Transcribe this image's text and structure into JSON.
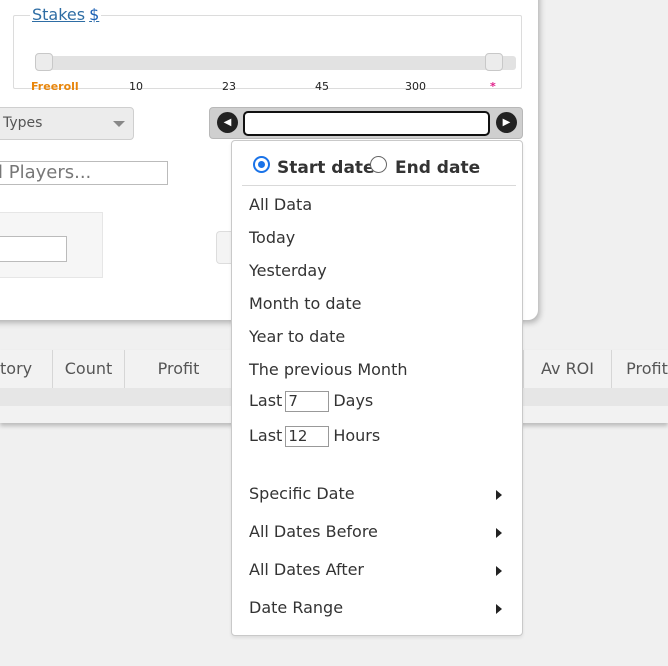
{
  "stakes": {
    "legend": "Stakes",
    "currency": "$",
    "ticks": [
      "Freeroll",
      "10",
      "23",
      "45",
      "300",
      "*"
    ]
  },
  "filters": {
    "types_label": "Types",
    "players_placeholder": "ll Players..."
  },
  "date_bar": {
    "prev_icon": "chevron-left-icon",
    "next_icon": "chevron-right-icon",
    "value": ""
  },
  "table": {
    "headers": [
      "tory",
      "Count",
      "Profit",
      "Av ROI",
      "Profit"
    ]
  },
  "date_menu": {
    "start_date_label": "Start date",
    "end_date_label": "End date",
    "start_selected": true,
    "items": [
      "All Data",
      "Today",
      "Yesterday",
      "Month to date",
      "Year to date",
      "The previous Month"
    ],
    "last_days": {
      "prefix": "Last",
      "value": "7",
      "suffix": "Days"
    },
    "last_hours": {
      "prefix": "Last",
      "value": "12",
      "suffix": "Hours"
    },
    "submenus": [
      "Specific Date",
      "All Dates Before",
      "All Dates After",
      "Date Range"
    ]
  },
  "colors": {
    "freeroll": "#e8860c",
    "star": "#e0208a",
    "link": "#2e6da4",
    "radio_accent": "#1a73e8"
  }
}
